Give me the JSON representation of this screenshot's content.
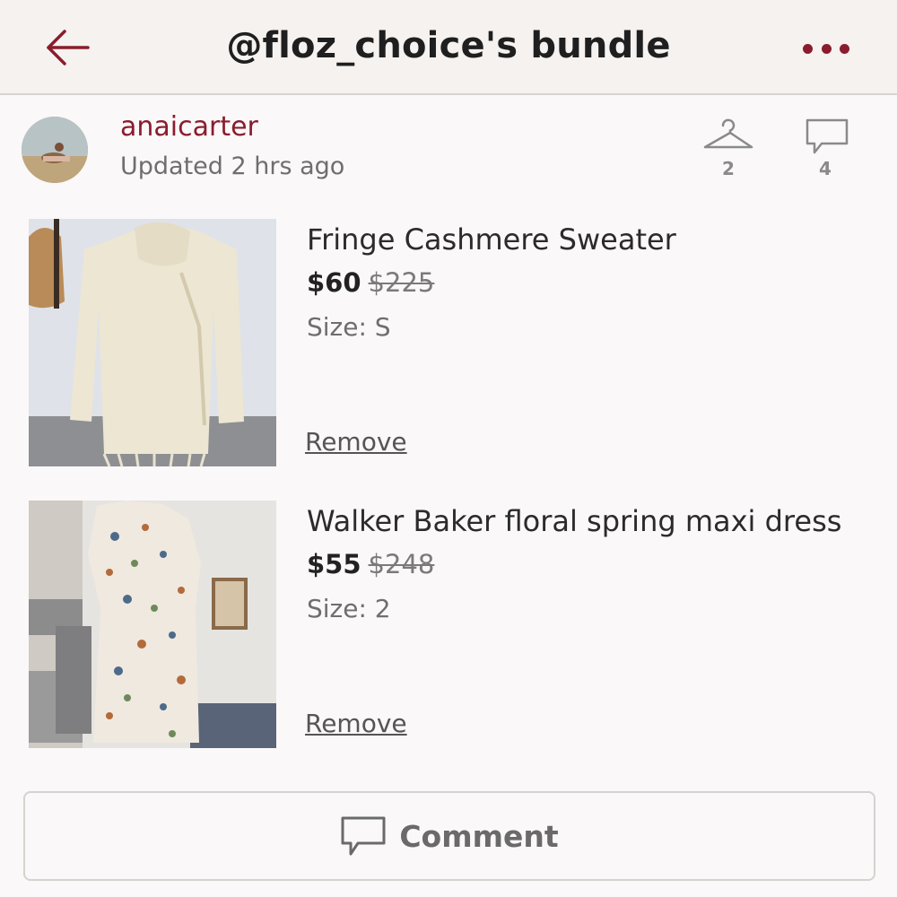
{
  "header": {
    "title": "@floz_choice's bundle",
    "back_icon": "arrow-left-icon",
    "more_icon": "more-dots-icon",
    "accent_color": "#8a1c2e"
  },
  "seller": {
    "username": "anaicarter",
    "updated": "Updated 2 hrs ago",
    "likes_count": "2",
    "comments_count": "4"
  },
  "items": [
    {
      "title": "Fringe Cashmere Sweater",
      "price": "$60",
      "original_price": "$225",
      "size": "Size: S",
      "remove_label": "Remove"
    },
    {
      "title": "Walker Baker floral spring maxi dress",
      "price": "$55",
      "original_price": "$248",
      "size": "Size: 2",
      "remove_label": "Remove"
    }
  ],
  "footer": {
    "comment_label": "Comment"
  }
}
